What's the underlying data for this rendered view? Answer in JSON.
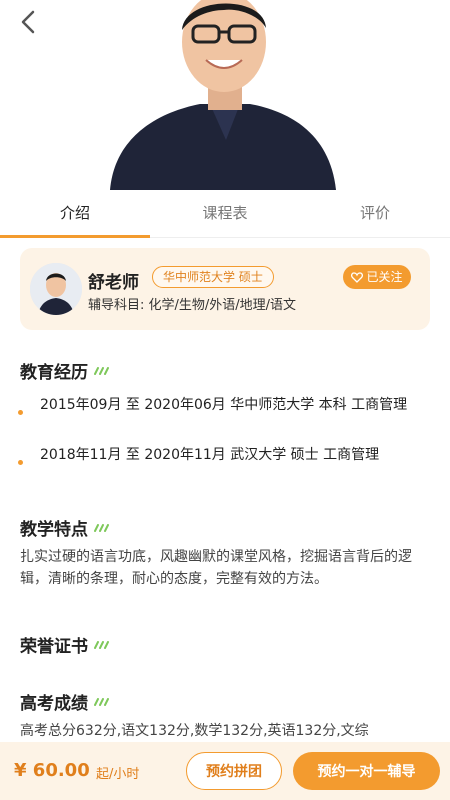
{
  "tabs": [
    {
      "label": "介绍",
      "active": true
    },
    {
      "label": "课程表",
      "active": false
    },
    {
      "label": "评价",
      "active": false
    }
  ],
  "teacher": {
    "name": "舒老师",
    "school_badge": "华中师范大学  硕士",
    "follow_label": "已关注",
    "subjects": "辅导科目: 化学/生物/外语/地理/语文"
  },
  "sections": {
    "education": {
      "title": "教育经历",
      "items": [
        "2015年09月 至 2020年06月 华中师范大学 本科 工商管理",
        "2018年11月 至 2020年11月 武汉大学 硕士 工商管理"
      ]
    },
    "teaching": {
      "title": "教学特点",
      "text": "扎实过硬的语言功底，风趣幽默的课堂风格，挖掘语言背后的逻辑，清晰的条理，耐心的态度，完整有效的方法。"
    },
    "honors": {
      "title": "荣誉证书"
    },
    "gaokao": {
      "title": "高考成绩",
      "text": "高考总分632分,语文132分,数学132分,英语132分,文综"
    }
  },
  "bottom": {
    "price": "¥ 60.00",
    "price_unit": "起/小时",
    "group_button": "预约拼团",
    "book_button": "预约一对一辅导"
  },
  "colors": {
    "accent": "#f39b2f",
    "card_bg": "#fdf3e6",
    "price": "#e07f1c"
  },
  "icons": [
    "back-arrow-icon",
    "heart-icon"
  ]
}
